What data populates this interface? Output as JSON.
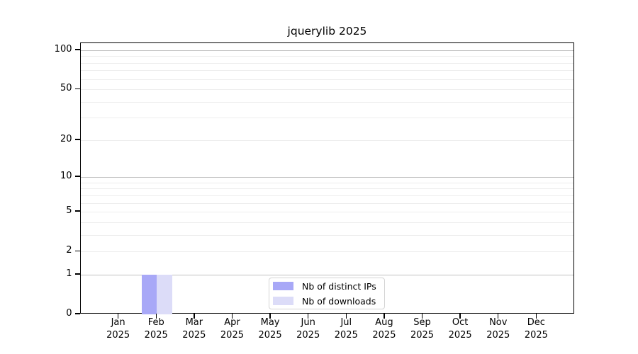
{
  "title": "jquerylib 2025",
  "chart_data": {
    "type": "bar",
    "title": "jquerylib 2025",
    "categories": [
      "Jan",
      "Feb",
      "Mar",
      "Apr",
      "May",
      "Jun",
      "Jul",
      "Aug",
      "Sep",
      "Oct",
      "Nov",
      "Dec"
    ],
    "year_label": "2025",
    "series": [
      {
        "name": "Nb of distinct IPs",
        "color": "#a8a8f7",
        "values": [
          0,
          1,
          0,
          0,
          0,
          0,
          0,
          0,
          0,
          0,
          0,
          0
        ]
      },
      {
        "name": "Nb of downloads",
        "color": "#dcdcf8",
        "values": [
          0,
          1,
          0,
          0,
          0,
          0,
          0,
          0,
          0,
          0,
          0,
          0
        ]
      }
    ],
    "xlabel": "",
    "ylabel": "",
    "y_scale": "log1p",
    "ylim": [
      0,
      113
    ],
    "y_tick_values": [
      0,
      1,
      2,
      5,
      10,
      20,
      50,
      100
    ],
    "y_grid_major_values": [
      1,
      10,
      100
    ],
    "y_grid_minor_values": [
      2,
      3,
      4,
      5,
      6,
      7,
      8,
      9,
      20,
      30,
      40,
      50,
      60,
      70,
      80,
      90
    ],
    "grid": "on",
    "legend_position": "bottom-center"
  },
  "colors": {
    "background": "#ffffff",
    "axis": "#000000",
    "grid_major": "#c0c0c0",
    "grid_minor": "#ededed",
    "bar_distinct_ips": "#a8a8f7",
    "bar_downloads": "#dcdcf8",
    "legend_border": "#d4d4d4",
    "text": "#000000"
  }
}
